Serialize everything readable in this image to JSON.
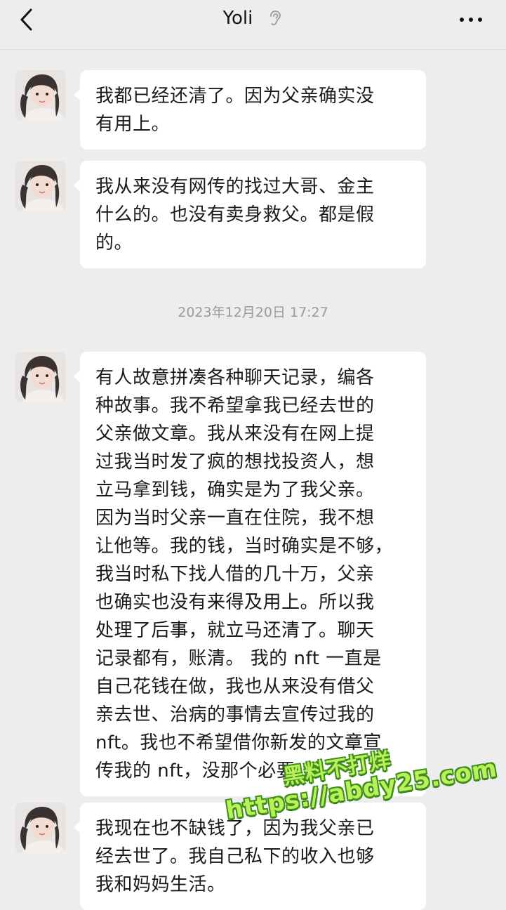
{
  "header": {
    "title": "Yoli",
    "back_icon": "chevron-left-icon",
    "ear_icon": "ear-icon",
    "more_icon": "more-dots-icon"
  },
  "timestamp": "2023年12月20日 17:27",
  "messages": [
    {
      "text": "我都已经还清了。因为父亲确实没\n有用上。"
    },
    {
      "text": "我从来没有网传的找过大哥、金主\n什么的。也没有卖身救父。都是假\n的。"
    },
    {
      "text": "有人故意拼凑各种聊天记录，编各\n种故事。我不希望拿我已经去世的\n父亲做文章。我从来没有在网上提\n过我当时发了疯的想找投资人，想\n立马拿到钱，确实是为了我父亲。\n因为当时父亲一直在住院，我不想\n让他等。我的钱，当时确实是不够，\n我当时私下找人借的几十万，父亲\n也确实也没有来得及用上。所以我\n处理了后事，就立马还清了。聊天\n记录都有，账清。 我的 nft 一直是\n自己花钱在做，我也从来没有借父\n亲去世、治病的事情去宣传过我的\nnft。我也不希望借你新发的文章宣\n传我的 nft，没那个必要。"
    },
    {
      "text": "我现在也不缺钱了，因为我父亲已\n经去世了。我自己私下的收入也够\n我和妈妈生活。"
    }
  ],
  "watermark": {
    "line1": "黑料不打烊",
    "line2": "https://abdy25.com"
  },
  "colors": {
    "background": "#ededed",
    "bubble": "#ffffff",
    "timestamp": "#9a9a9a",
    "watermark_fill": "#b9f15a",
    "watermark_outline": "#3f8f1a"
  }
}
